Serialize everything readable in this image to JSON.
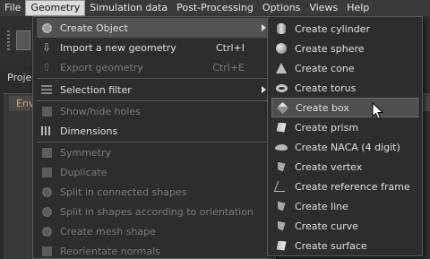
{
  "menubar": {
    "items": [
      "File",
      "Geometry",
      "Simulation data",
      "Post-Processing",
      "Options",
      "Views",
      "Help"
    ]
  },
  "background": {
    "project_label": "Proje",
    "env_tab": "Env"
  },
  "geometry_menu": {
    "create_object": "Create Object",
    "import_geometry": "Import a new geometry",
    "import_shortcut": "Ctrl+I",
    "export_geometry": "Export geometry",
    "export_shortcut": "Ctrl+E",
    "selection_filter": "Selection filter",
    "show_hide_holes": "Show/hide holes",
    "dimensions": "Dimensions",
    "symmetry": "Symmetry",
    "duplicate": "Duplicate",
    "split_connected": "Split in connected shapes",
    "split_orientation": "Split in shapes according to orientation",
    "create_mesh_shape": "Create mesh shape",
    "reorientate_normals": "Reorientate normals"
  },
  "create_object_menu": {
    "items": [
      {
        "label": "Create cylinder",
        "icon": "cylinder-icon"
      },
      {
        "label": "Create sphere",
        "icon": "sphere-icon"
      },
      {
        "label": "Create cone",
        "icon": "cone-icon"
      },
      {
        "label": "Create torus",
        "icon": "torus-icon"
      },
      {
        "label": "Create box",
        "icon": "box-icon"
      },
      {
        "label": "Create prism",
        "icon": "prism-icon"
      },
      {
        "label": "Create NACA (4 digit)",
        "icon": "naca-icon"
      },
      {
        "label": "Create vertex",
        "icon": "vertex-icon"
      },
      {
        "label": "Create reference frame",
        "icon": "reference-frame-icon"
      },
      {
        "label": "Create line",
        "icon": "line-icon"
      },
      {
        "label": "Create curve",
        "icon": "curve-icon"
      },
      {
        "label": "Create surface",
        "icon": "surface-icon"
      }
    ],
    "highlighted": "Create box"
  }
}
